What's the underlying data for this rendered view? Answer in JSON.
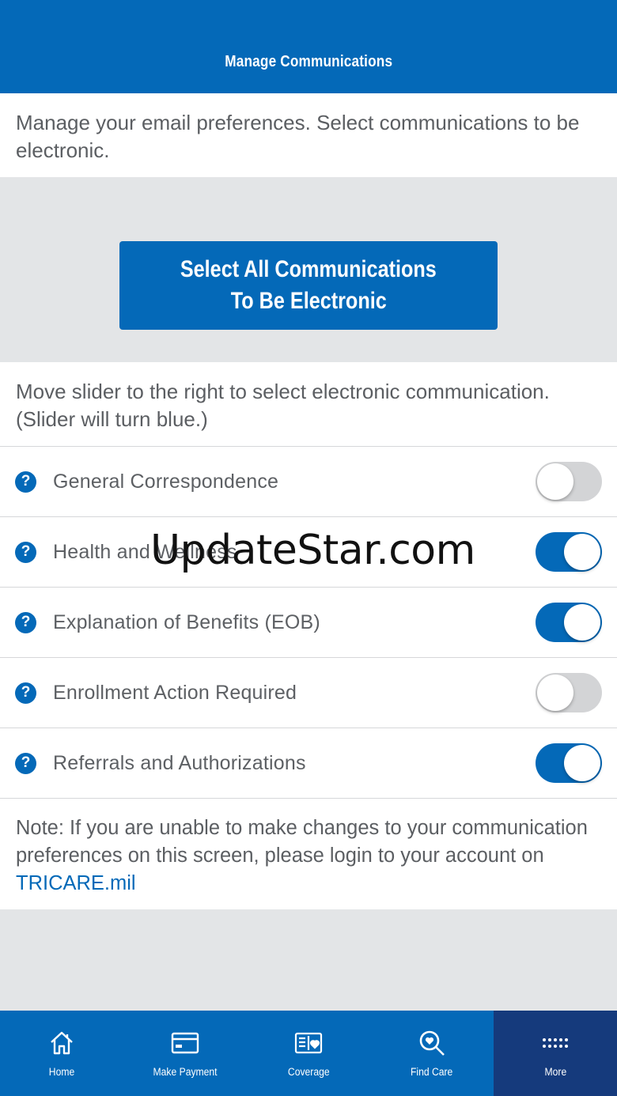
{
  "header": {
    "title": "Manage Communications"
  },
  "intro": {
    "text": "Manage your email preferences. Select communications to be electronic."
  },
  "cta": {
    "line1": "Select All Communications",
    "line2": "To Be Electronic"
  },
  "instructions": {
    "text": "Move slider to the right to select electronic communication. (Slider will turn blue.)"
  },
  "preferences": [
    {
      "label": "General Correspondence",
      "enabled": false,
      "icon": "help-icon"
    },
    {
      "label": "Health and Wellness",
      "enabled": true,
      "icon": "help-icon"
    },
    {
      "label": "Explanation of Benefits (EOB)",
      "enabled": true,
      "icon": "help-icon"
    },
    {
      "label": "Enrollment Action Required",
      "enabled": false,
      "icon": "help-icon"
    },
    {
      "label": "Referrals and Authorizations",
      "enabled": true,
      "icon": "help-icon"
    }
  ],
  "help_glyph": "?",
  "note": {
    "text": "Note: If you are unable to make changes to your communication preferences on this screen, please login to your account on ",
    "link": "TRICARE.mil"
  },
  "watermark": "UpdateStar.com",
  "tabs": [
    {
      "label": "Home",
      "icon": "home-icon",
      "active": false
    },
    {
      "label": "Make Payment",
      "icon": "credit-card-icon",
      "active": false
    },
    {
      "label": "Coverage",
      "icon": "id-card-icon",
      "active": false
    },
    {
      "label": "Find Care",
      "icon": "search-heart-icon",
      "active": false
    },
    {
      "label": "More",
      "icon": "more-dots-icon",
      "active": true
    }
  ],
  "colors": {
    "primary": "#0469b8",
    "active_tab": "#153a7c",
    "background": "#e3e5e7",
    "toggle_off": "#d3d4d6"
  }
}
